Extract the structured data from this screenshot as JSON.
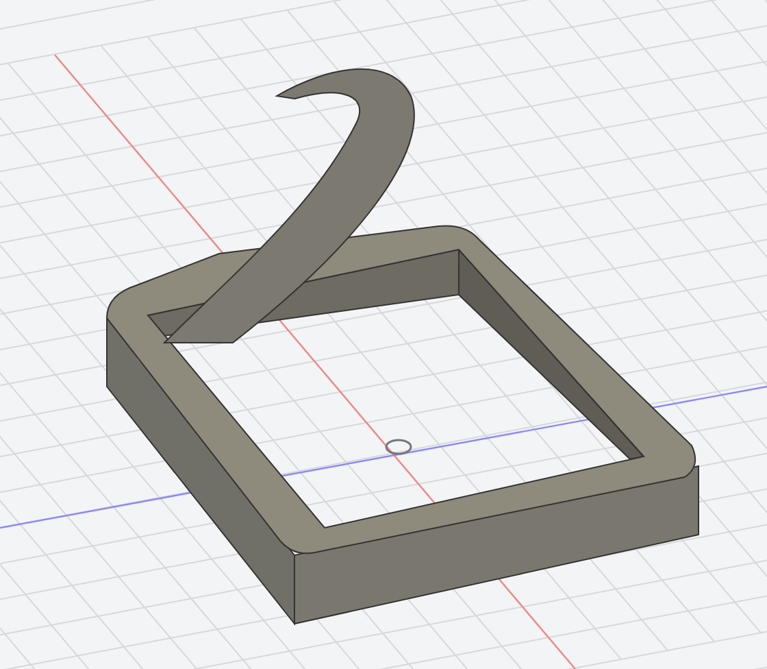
{
  "viewport": {
    "grid_visible": true,
    "origin_marker": true,
    "axes_visible": true
  }
}
